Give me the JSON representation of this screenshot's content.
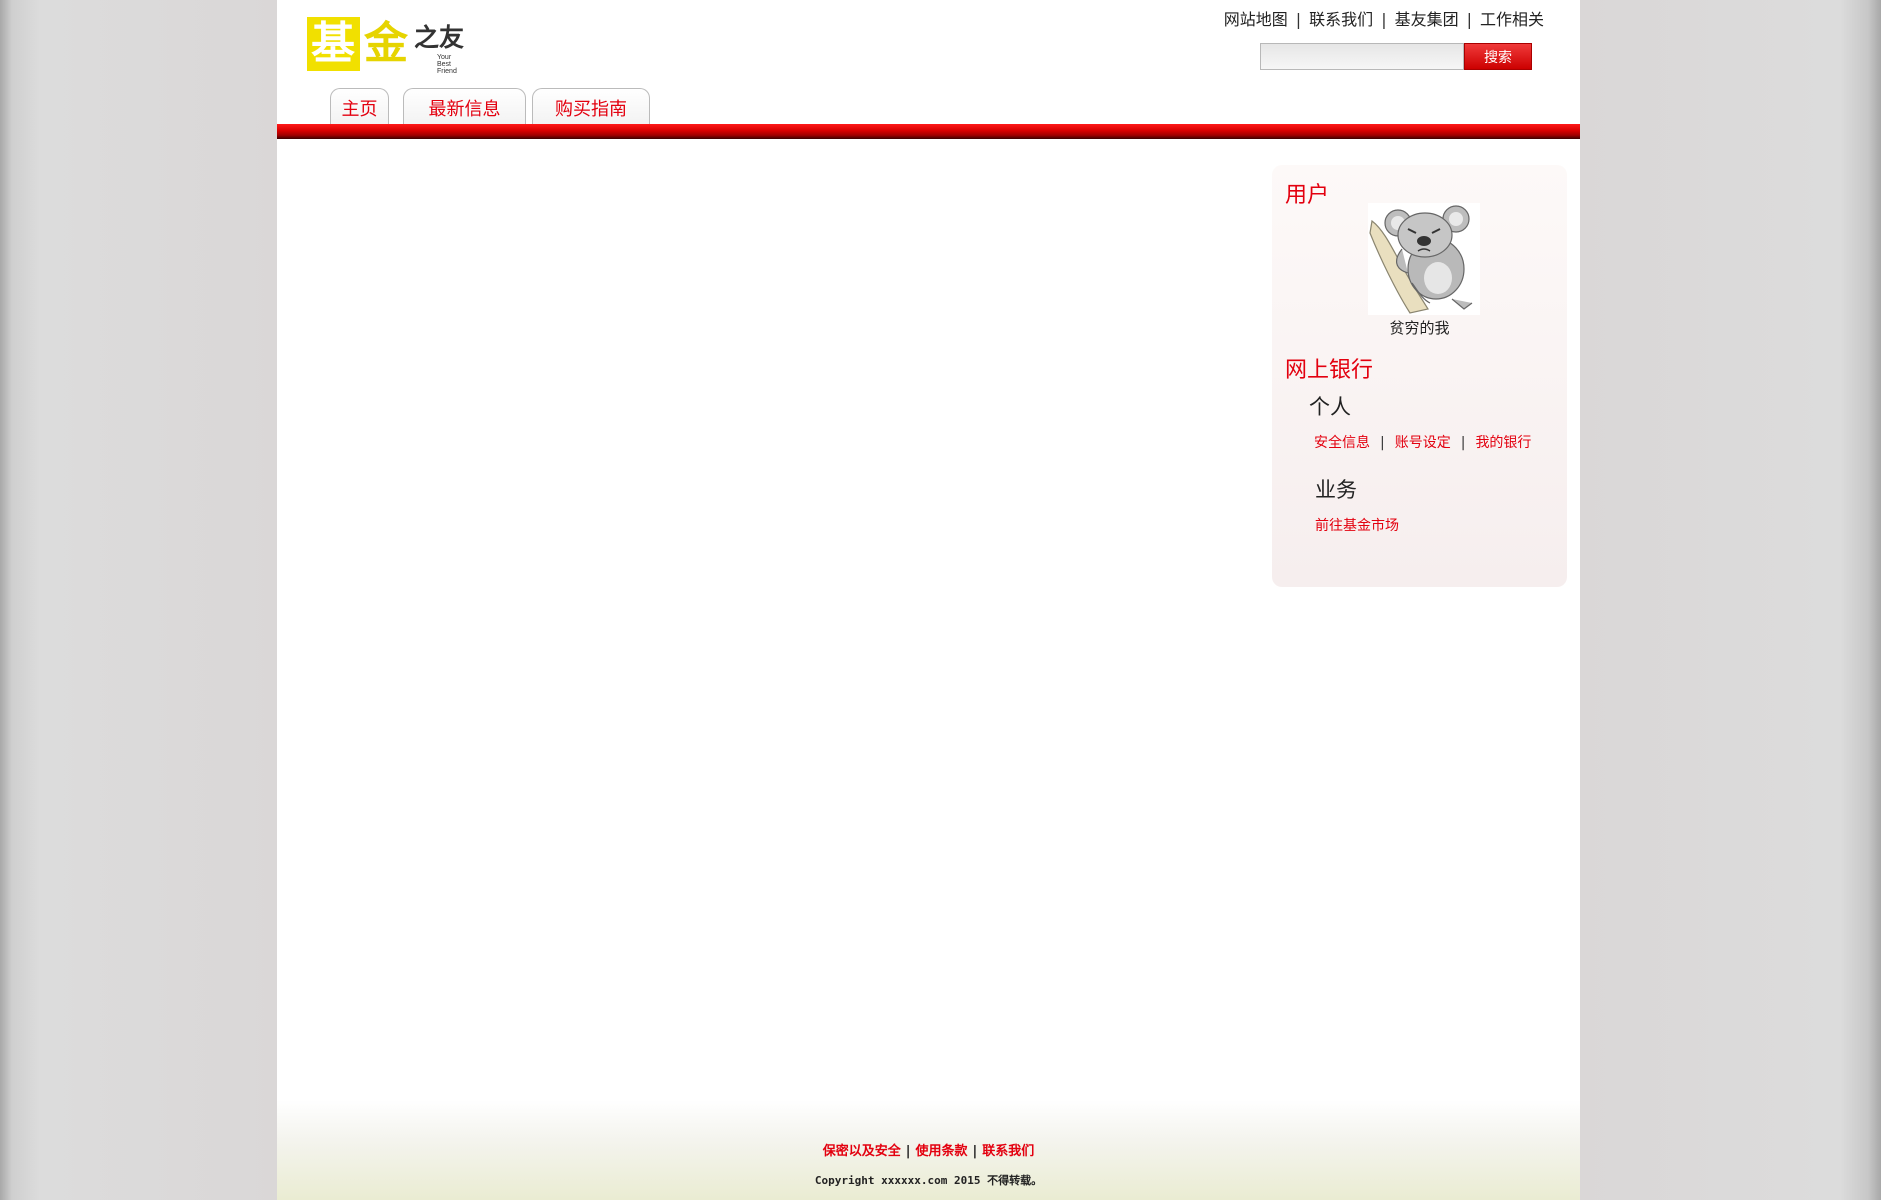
{
  "brand": {
    "logo_char1": "基",
    "logo_char2": "金",
    "logo_suffix": "之友",
    "tagline": "Your Best Friend"
  },
  "top_links": [
    "网站地图",
    "联系我们",
    "基友集团",
    "工作相关"
  ],
  "search": {
    "placeholder": "",
    "button_label": "搜索"
  },
  "nav": {
    "tabs": [
      {
        "label": "主页"
      },
      {
        "label": "最新信息"
      },
      {
        "label": "购买指南"
      }
    ]
  },
  "sidebar": {
    "user_heading": "用户",
    "username": "贫穷的我",
    "bank_heading": "网上银行",
    "personal": {
      "heading": "个人",
      "links": [
        "安全信息",
        "账号设定",
        "我的银行"
      ]
    },
    "business": {
      "heading": "业务",
      "link": "前往基金市场"
    }
  },
  "footer": {
    "links": [
      "保密以及安全",
      "使用条款",
      "联系我们"
    ],
    "copyright": "Copyright xxxxxx.com 2015 不得转载。"
  },
  "colors": {
    "accent": "#e3000f",
    "logo_yellow": "#f1e000",
    "nav_bar_red": "#d80000"
  },
  "icons": {
    "avatar": "koala-avatar-icon"
  }
}
